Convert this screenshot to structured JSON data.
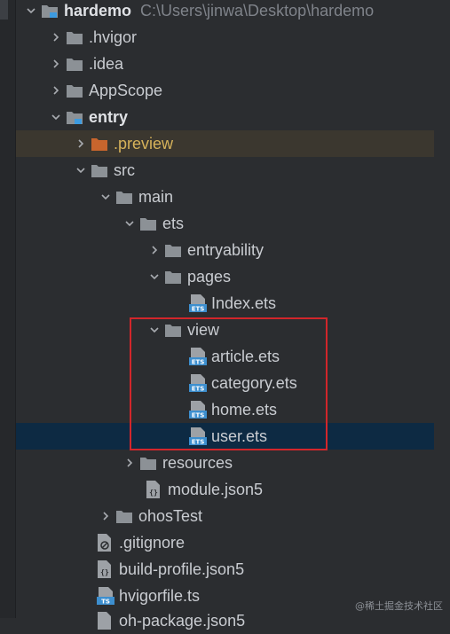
{
  "project": {
    "name": "hardemo",
    "path": "C:\\Users\\jinwa\\Desktop\\hardemo"
  },
  "tree": {
    "hvigor": ".hvigor",
    "idea": ".idea",
    "appscope": "AppScope",
    "entry": "entry",
    "preview": ".preview",
    "src": "src",
    "main": "main",
    "ets": "ets",
    "entryability": "entryability",
    "pages": "pages",
    "index_ets": "Index.ets",
    "view": "view",
    "article_ets": "article.ets",
    "category_ets": "category.ets",
    "home_ets": "home.ets",
    "user_ets": "user.ets",
    "resources": "resources",
    "module_json5": "module.json5",
    "ohostest": "ohosTest",
    "gitignore": ".gitignore",
    "build_profile": "build-profile.json5",
    "hvigorfile": "hvigorfile.ts",
    "last_partial": "oh-package.json5"
  },
  "icons": {
    "ets_badge": "ETS",
    "ts_badge": "TS"
  },
  "colors": {
    "folder": "#8c9196",
    "preview_folder": "#c8652d",
    "module_marker": "#3d9be0",
    "selection": "#0d2a43",
    "highlight_box": "#d2262b"
  },
  "watermark": "@稀土掘金技术社区"
}
